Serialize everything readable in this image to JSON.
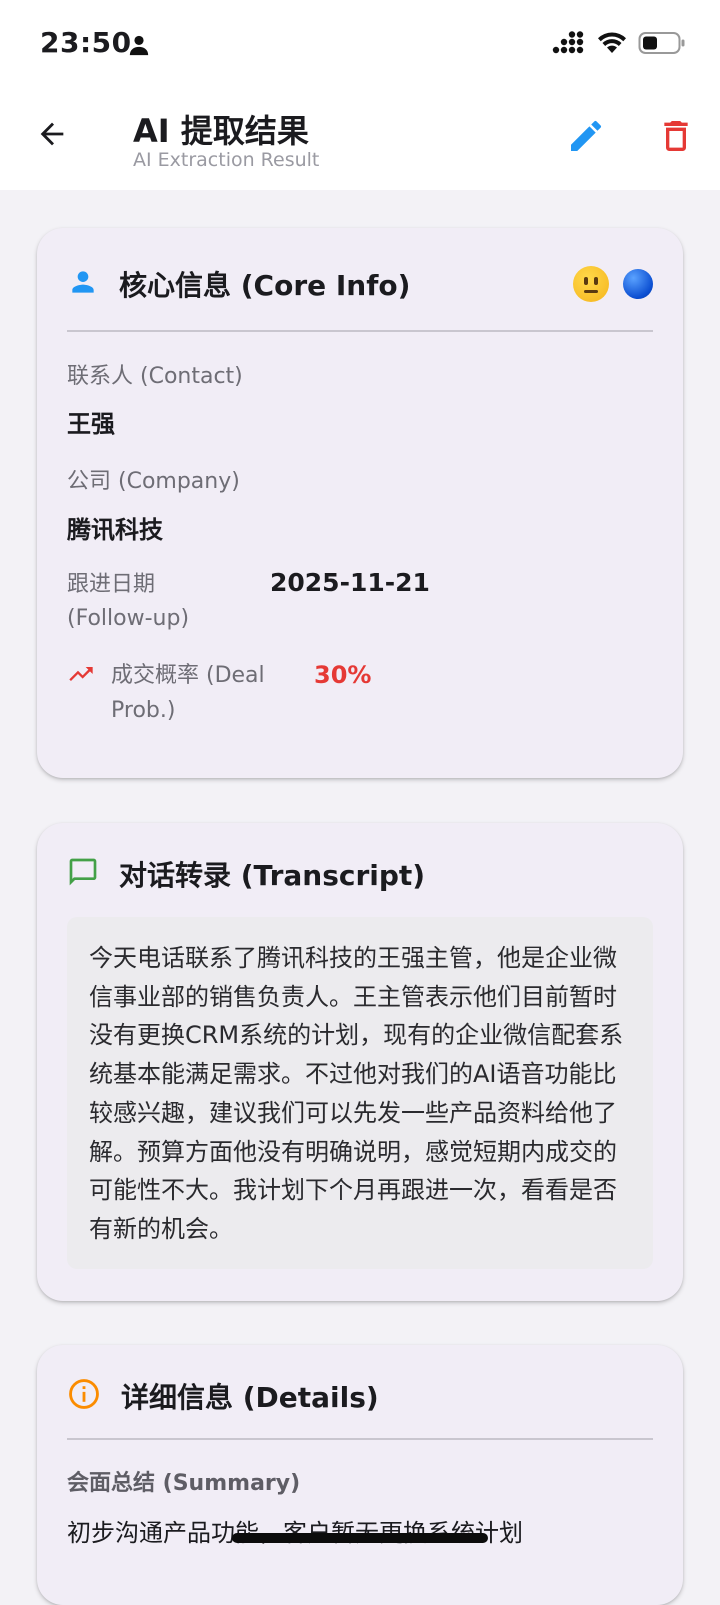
{
  "status_bar": {
    "time": "23:50"
  },
  "app_bar": {
    "title": "AI 提取结果",
    "subtitle": "AI Extraction Result",
    "icons": {
      "back": "arrow-back-icon",
      "edit": "edit-pencil-icon",
      "delete": "trash-icon"
    }
  },
  "core_info": {
    "title": "核心信息 (Core Info)",
    "contact_label": "联系人 (Contact)",
    "contact_value": "王强",
    "company_label": "公司 (Company)",
    "company_value": "腾讯科技",
    "followup_label_line1": "跟进日期",
    "followup_label_line2": "(Follow-up)",
    "followup_value": "2025-11-21",
    "deal_label_line1": "成交概率 (Deal",
    "deal_label_line2": "Prob.)",
    "deal_value": "30%"
  },
  "transcript": {
    "title": "对话转录 (Transcript)",
    "text": "今天电话联系了腾讯科技的王强主管，他是企业微信事业部的销售负责人。王主管表示他们目前暂时没有更换CRM系统的计划，现有的企业微信配套系统基本能满足需求。不过他对我们的AI语音功能比较感兴趣，建议我们可以先发一些产品资料给他了解。预算方面他没有明确说明，感觉短期内成交的可能性不大。我计划下个月再跟进一次，看看是否有新的机会。"
  },
  "details": {
    "title": "详细信息 (Details)",
    "summary_label": "会面总结 (Summary)",
    "summary_value": "初步沟通产品功能，客户暂无更换系统计划"
  },
  "colors": {
    "accent_blue": "#2196f3",
    "delete_red": "#e53935",
    "deal_red": "#e53935",
    "transcript_green": "#43a047",
    "details_orange": "#fb8c00",
    "card_bg": "#f1edf6",
    "page_bg": "#f3f2f6"
  }
}
